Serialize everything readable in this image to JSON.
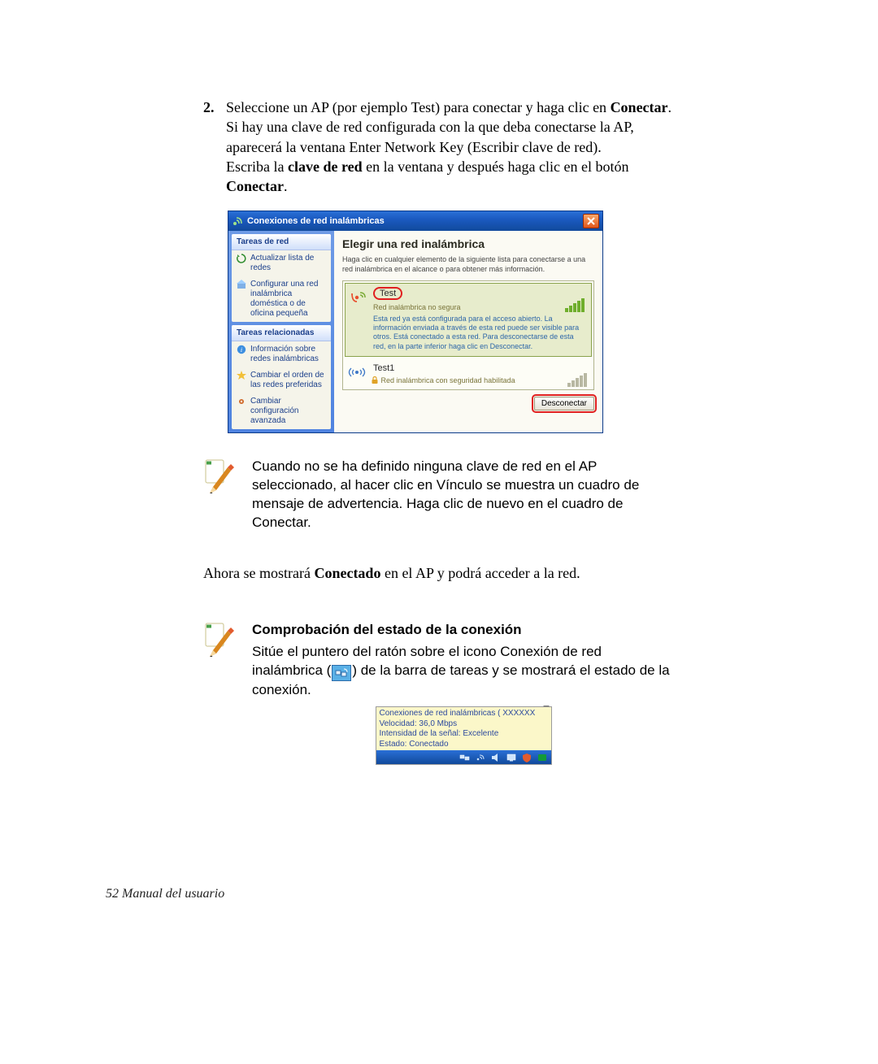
{
  "step": {
    "number": "2.",
    "line1_a": "Seleccione un AP (por ejemplo Test) para conectar y haga clic en ",
    "line1_b": "Conectar",
    "line1_c": ".",
    "line2": "Si hay una clave de red configurada con la que deba conectarse la AP, aparecerá la ventana Enter Network Key (Escribir clave de red).",
    "line3_a": "Escriba la ",
    "line3_b": "clave de red",
    "line3_c": " en la ventana y después haga clic en el botón ",
    "line3_d": "Conectar",
    "line3_e": "."
  },
  "dialog": {
    "title": "Conexiones de red inalámbricas",
    "sidebar": {
      "section1_title": "Tareas de red",
      "items1": {
        "refresh": "Actualizar lista de redes",
        "setup": "Configurar una red inalámbrica doméstica o de oficina pequeña"
      },
      "section2_title": "Tareas relacionadas",
      "items2": {
        "info": "Información sobre redes inalámbricas",
        "order": "Cambiar el orden de las redes preferidas",
        "adv": "Cambiar configuración avanzada"
      }
    },
    "content": {
      "heading": "Elegir una red inalámbrica",
      "sub": "Haga clic en cualquier elemento de la siguiente lista para conectarse a una red inalámbrica en el alcance o para obtener más información.",
      "nets": {
        "n0": {
          "name": "Test",
          "line2": "Red inalámbrica no segura",
          "desc": "Esta red ya está configurada para el acceso abierto. La información enviada a través de esta red puede ser visible para otros. Está conectado a esta red. Para desconectarse de esta red, en la parte inferior haga clic en Desconectar."
        },
        "n1": {
          "name": "Test1",
          "line2": "Red inalámbrica con seguridad habilitada"
        }
      },
      "disconnect_btn": "Desconectar"
    }
  },
  "note1": "Cuando no se ha definido ninguna clave de red en el AP seleccionado, al hacer clic en Vínculo se muestra un cuadro de mensaje de advertencia. Haga clic de nuevo en el cuadro de Conectar.",
  "para2_a": "Ahora se mostrará ",
  "para2_b": "Conectado",
  "para2_c": " en el AP y podrá acceder a la red.",
  "note2": {
    "heading": "Comprobación del estado de la conexión",
    "text_a": "Sitúe el puntero del ratón sobre el icono Conexión de red inalámbrica (",
    "text_b": ") de la barra de tareas y se mostrará el estado de la conexión."
  },
  "tray": {
    "l1": "Conexiones de red inalámbricas (  XXXXXX",
    "l2": "Velocidad: 36,0 Mbps",
    "l3": "Intensidad de la señal: Excelente",
    "l4": "Estado: Conectado"
  },
  "footer": "52  Manual del usuario"
}
